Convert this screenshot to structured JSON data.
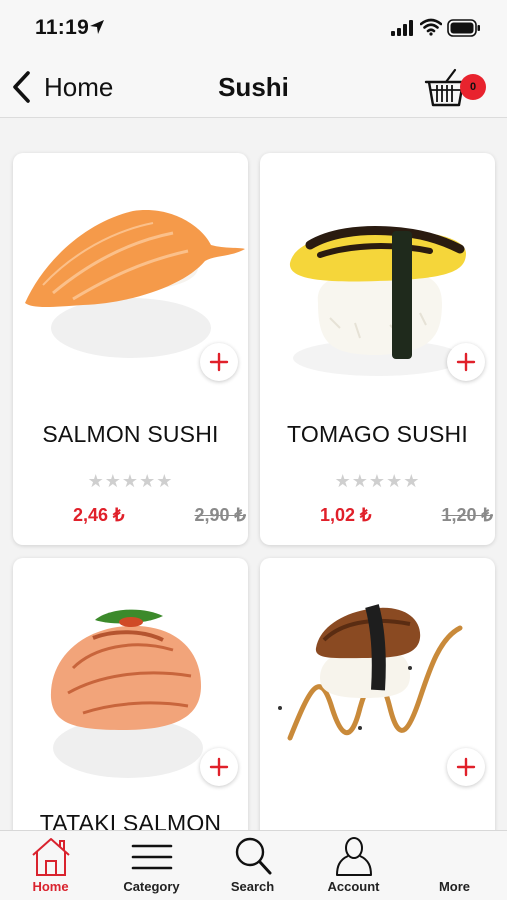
{
  "status_bar": {
    "time": "11:19"
  },
  "nav": {
    "back_label": "Home",
    "title": "Sushi",
    "cart_count": "0"
  },
  "products": [
    {
      "name": "SALMON SUSHI",
      "rating": "★★★★★",
      "price": "2,46 ₺",
      "old_price": "2,90 ₺"
    },
    {
      "name": "TOMAGO SUSHI",
      "rating": "★★★★★",
      "price": "1,02 ₺",
      "old_price": "1,20 ₺"
    },
    {
      "name": "TATAKI SALMON",
      "rating": "",
      "price": "",
      "old_price": ""
    },
    {
      "name": "",
      "rating": "",
      "price": "",
      "old_price": ""
    }
  ],
  "tabs": [
    {
      "label": "Home",
      "icon": "home-icon",
      "active": true
    },
    {
      "label": "Category",
      "icon": "menu-icon",
      "active": false
    },
    {
      "label": "Search",
      "icon": "search-icon",
      "active": false
    },
    {
      "label": "Account",
      "icon": "account-icon",
      "active": false
    },
    {
      "label": "More",
      "icon": "more-icon",
      "active": false
    }
  ],
  "colors": {
    "accent": "#e0202a",
    "badge": "#e8232e",
    "background": "#f3f3f3"
  }
}
